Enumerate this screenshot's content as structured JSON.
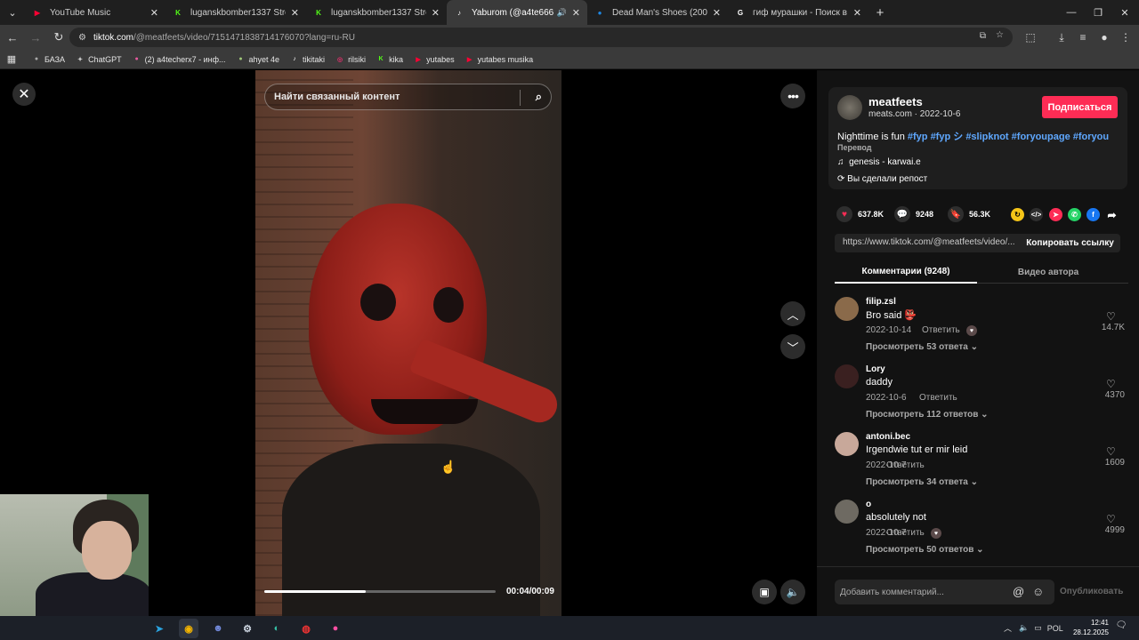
{
  "browser": {
    "tabs": [
      {
        "title": "YouTube Music",
        "fav": "▶",
        "favColor": "#ff0033",
        "active": false
      },
      {
        "title": "luganskbomber1337 Stream - K",
        "fav": "K",
        "favColor": "#53fc18",
        "active": false
      },
      {
        "title": "luganskbomber1337 Stream - V",
        "fav": "K",
        "favColor": "#53fc18",
        "active": false
      },
      {
        "title": "Yaburom (@a4te666) | TikTo",
        "fav": "♪",
        "favColor": "#ffffff",
        "active": true,
        "audio": "🔊"
      },
      {
        "title": "Dead Man's Shoes (2004) direc",
        "fav": "●",
        "favColor": "#1e88e5",
        "active": false
      },
      {
        "title": "гиф мурашки - Поиск в Google",
        "fav": "G",
        "favColor": "#ffffff",
        "active": false
      }
    ],
    "url_host": "tiktok.com",
    "url_path": "/@meatfeets/video/7151471838714176070?lang=ru-RU",
    "bookmarks": [
      {
        "label": "БАЗА",
        "color": "#aaaaaa",
        "glyph": "●"
      },
      {
        "label": "ChatGPT",
        "color": "#cccccc",
        "glyph": "✦"
      },
      {
        "label": "(2) a4techerx7 - инф...",
        "color": "#e85aa0",
        "glyph": "●"
      },
      {
        "label": "ahyet 4e",
        "color": "#a0c878",
        "glyph": "●"
      },
      {
        "label": "tikitaki",
        "color": "#ffffff",
        "glyph": "♪"
      },
      {
        "label": "rilsiki",
        "color": "#e1306c",
        "glyph": "◎"
      },
      {
        "label": "kika",
        "color": "#53fc18",
        "glyph": "K"
      },
      {
        "label": "yutabes",
        "color": "#ff0033",
        "glyph": "▶"
      },
      {
        "label": "yutabes musika",
        "color": "#ff0033",
        "glyph": "▶"
      }
    ]
  },
  "video": {
    "search_placeholder": "Найти связанный контент",
    "time": "00:04/00:09",
    "progress": 0.44
  },
  "author": {
    "name": "meatfeets",
    "meta": "meats.com · 2022-10-6",
    "follow": "Подписаться",
    "caption_text": "Nighttime is fun",
    "hashtags": [
      "#fyp",
      "#fyp シ",
      "#slipknot",
      "#foryoupage",
      "#foryou"
    ],
    "translate": "Перевод",
    "music": "genesis - karwai.e",
    "repost": "Вы сделали репост"
  },
  "stats": {
    "likes": "637.8K",
    "comments": "9248",
    "saves": "56.3K"
  },
  "share_link": {
    "url": "https://www.tiktok.com/@meatfeets/video/...",
    "copy": "Копировать ссылку"
  },
  "panel_tabs": {
    "comments": "Комментарии (9248)",
    "author_videos": "Видео автора"
  },
  "comments": [
    {
      "user": "filip.zsl",
      "text": "Bro said 👺",
      "date": "2022-10-14",
      "reply": "Ответить",
      "more": "Просмотреть 53 ответа",
      "likes": "14.7K",
      "avatar": "#8a6a4a",
      "liked_by_author": true
    },
    {
      "user": "Lory",
      "text": "daddy",
      "date": "2022-10-6",
      "reply": "Ответить",
      "more": "Просмотреть 112 ответов",
      "likes": "4370",
      "avatar": "#3a2020",
      "liked_by_author": false
    },
    {
      "user": "antoni.bec",
      "text": "Irgendwie tut er mir leid",
      "date": "2022-10-7",
      "reply": "Ответить",
      "more": "Просмотреть 34 ответа",
      "likes": "1609",
      "avatar": "#c8a89a",
      "liked_by_author": false
    },
    {
      "user": "o",
      "text": "absolutely not",
      "date": "2022-10-7",
      "reply": "Ответить",
      "more": "Просмотреть 50 ответов",
      "likes": "4999",
      "avatar": "#6e6a62",
      "liked_by_author": true
    }
  ],
  "comment_box": {
    "placeholder": "Добавить комментарий...",
    "post": "Опубликовать"
  },
  "taskbar": {
    "lang": "POL",
    "time": "12:41",
    "date": "28.12.2025"
  }
}
